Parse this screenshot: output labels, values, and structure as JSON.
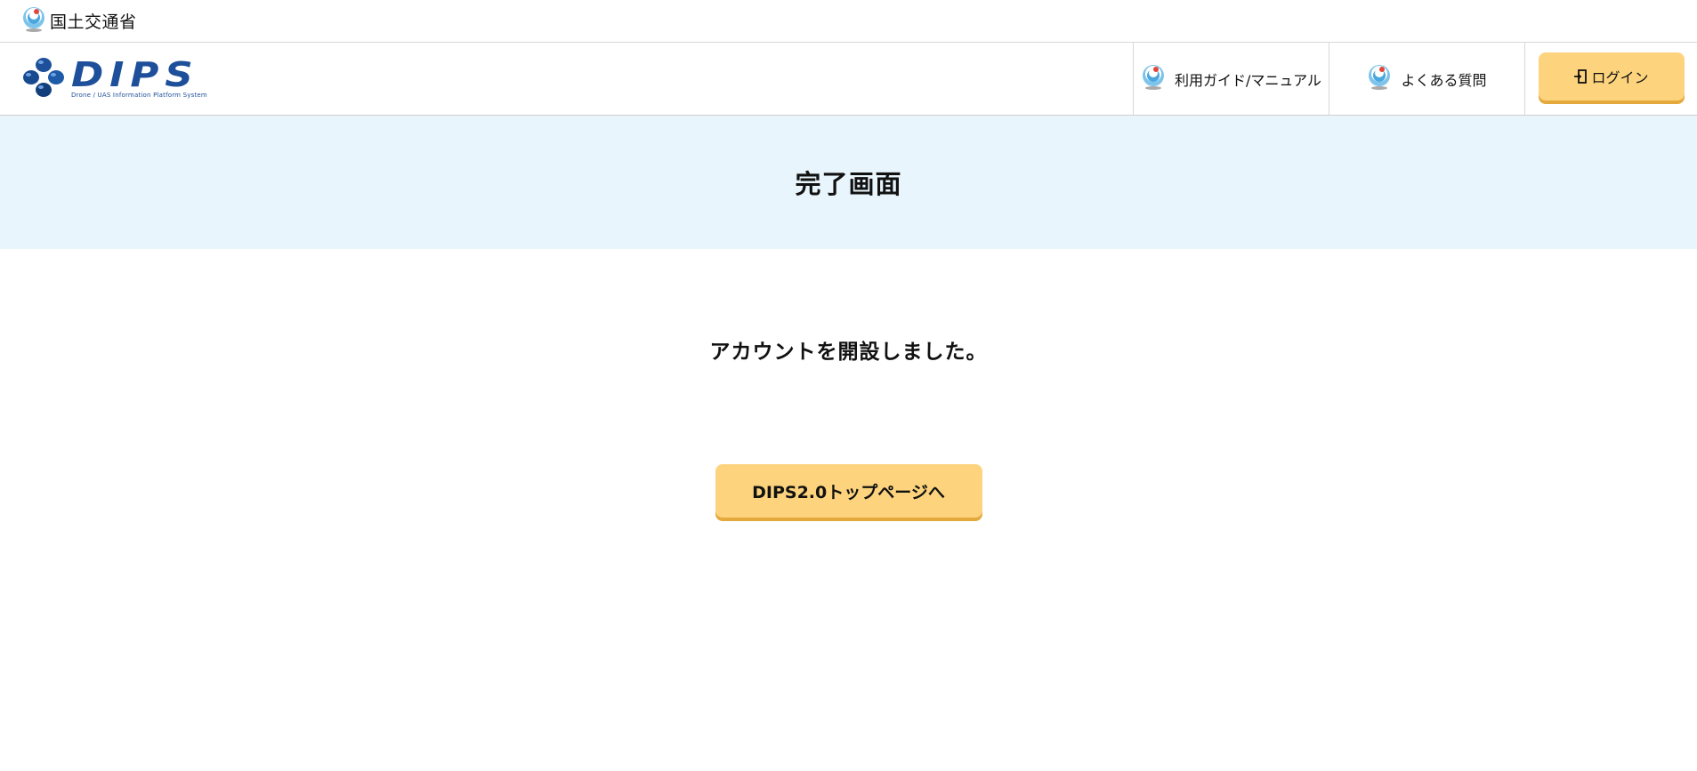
{
  "ministry": {
    "name": "国土交通省",
    "logo_icon": "mlit-logo-icon"
  },
  "header": {
    "brand_name": "DIPS",
    "brand_subtitle": "Drone / UAS Information Platform System",
    "logo_icon": "dips-logo-icon"
  },
  "nav": {
    "guide_label": "利用ガイド/マニュアル",
    "faq_label": "よくある質問",
    "login_label": "ログイン",
    "login_icon": "login-door-icon"
  },
  "page": {
    "title": "完了画面",
    "message": "アカウントを開設しました。",
    "top_button_label": "DIPS2.0トップページへ"
  },
  "colors": {
    "brand_blue": "#1d4f9a",
    "title_band_bg": "#e8f5fd",
    "button_bg": "#fdd47d",
    "button_shadow": "#e3a93c"
  }
}
